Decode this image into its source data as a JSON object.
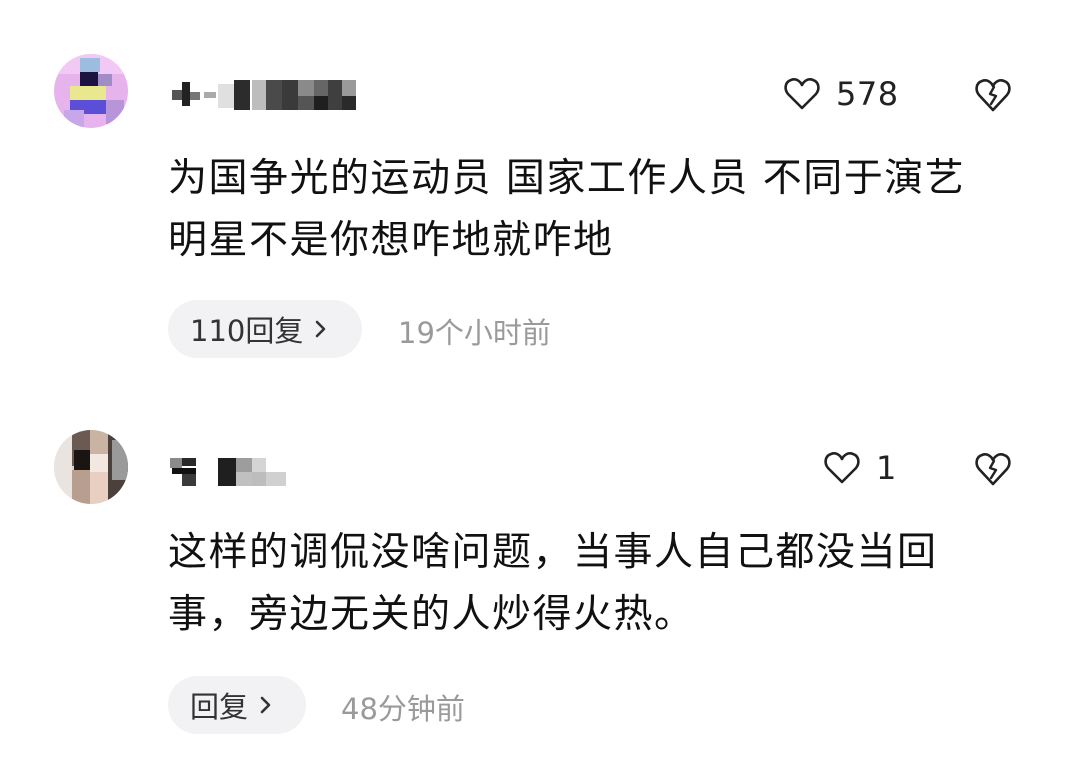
{
  "comments": [
    {
      "username_blurred": true,
      "likes": "578",
      "text_line1": "为国争光的运动员 国家工作人员 不同于演艺",
      "text_line2": "明星不是你想咋地就咋地",
      "reply_label": "110回复",
      "time": "19个小时前",
      "icons": {
        "like": "heart-outline-icon",
        "dislike": "broken-heart-icon",
        "chevron": "chevron-right-icon"
      }
    },
    {
      "username_blurred": true,
      "likes": "1",
      "text_line1": "这样的调侃没啥问题，当事人自己都没当回",
      "text_line2": "事，旁边无关的人炒得火热。",
      "reply_label": "回复",
      "time": "48分钟前",
      "icons": {
        "like": "heart-outline-icon",
        "dislike": "broken-heart-icon",
        "chevron": "chevron-right-icon"
      }
    }
  ],
  "colors": {
    "background": "#ffffff",
    "text": "#111111",
    "muted": "#9a9a9a",
    "pill": "#f2f2f4"
  }
}
